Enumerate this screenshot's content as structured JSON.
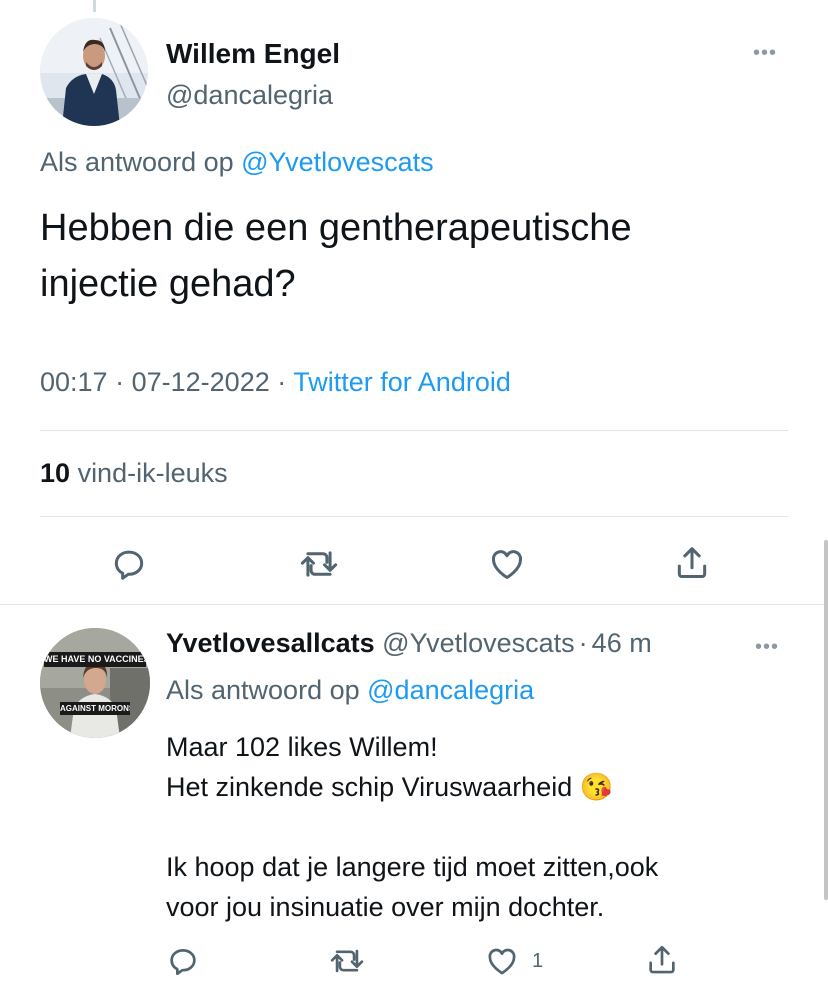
{
  "main_tweet": {
    "author_name": "Willem Engel",
    "author_handle": "@dancalegria",
    "reply_prefix": "Als antwoord op",
    "reply_to": "@Yvetlovescats",
    "text_line1": "Hebben die een gentherapeutische",
    "text_line2": "injectie gehad?",
    "time": "00:17",
    "date": "07-12-2022",
    "source": "Twitter for Android",
    "likes_count": "10",
    "likes_label": "vind-ik-leuks",
    "more_icon": "more-icon"
  },
  "reply_tweet": {
    "author_name": "Yvetlovesallcats",
    "author_handle": "@Yvetlovescats",
    "time_ago": "46 m",
    "reply_prefix": "Als antwoord op",
    "reply_to": "@dancalegria",
    "line1": "Maar 102 likes Willem!",
    "line2": "Het zinkende schip Viruswaarheid",
    "emoji": "😘",
    "line3": "Ik hoop dat je langere tijd moet zitten,ook",
    "line4": "voor jou insinuatie over mijn dochter.",
    "like_count": "1",
    "avatar_banner_top": "WE HAVE NO VACCINES",
    "avatar_banner_bottom": "AGAINST MORONS"
  },
  "separators": {
    "dot": "·"
  },
  "colors": {
    "link": "#1d9bf0",
    "muted": "#536471",
    "text": "#0f1419",
    "divider": "#e1e6ea"
  }
}
